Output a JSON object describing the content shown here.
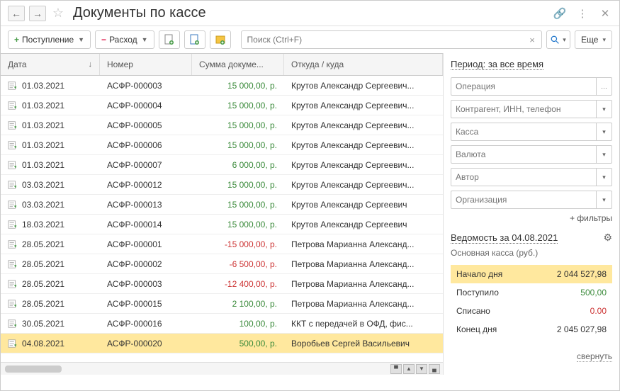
{
  "header": {
    "title": "Документы по кассе"
  },
  "toolbar": {
    "income_btn": "Поступление",
    "expense_btn": "Расход",
    "search_placeholder": "Поиск (Ctrl+F)",
    "more_btn": "Еще"
  },
  "columns": {
    "date": "Дата",
    "number": "Номер",
    "sum": "Сумма докуме...",
    "where": "Откуда / куда"
  },
  "rows": [
    {
      "date": "01.03.2021",
      "num": "АСФР-000003",
      "amt": "15 000,00, р.",
      "cls": "pos",
      "who": "Крутов Александр Сергеевич..."
    },
    {
      "date": "01.03.2021",
      "num": "АСФР-000004",
      "amt": "15 000,00, р.",
      "cls": "pos",
      "who": "Крутов Александр Сергеевич..."
    },
    {
      "date": "01.03.2021",
      "num": "АСФР-000005",
      "amt": "15 000,00, р.",
      "cls": "pos",
      "who": "Крутов Александр Сергеевич..."
    },
    {
      "date": "01.03.2021",
      "num": "АСФР-000006",
      "amt": "15 000,00, р.",
      "cls": "pos",
      "who": "Крутов Александр Сергеевич..."
    },
    {
      "date": "01.03.2021",
      "num": "АСФР-000007",
      "amt": "6 000,00, р.",
      "cls": "pos",
      "who": "Крутов Александр Сергеевич..."
    },
    {
      "date": "03.03.2021",
      "num": "АСФР-000012",
      "amt": "15 000,00, р.",
      "cls": "pos",
      "who": "Крутов Александр Сергеевич..."
    },
    {
      "date": "03.03.2021",
      "num": "АСФР-000013",
      "amt": "15 000,00, р.",
      "cls": "pos",
      "who": "Крутов Александр Сергеевич"
    },
    {
      "date": "18.03.2021",
      "num": "АСФР-000014",
      "amt": "15 000,00, р.",
      "cls": "pos",
      "who": "Крутов Александр Сергеевич"
    },
    {
      "date": "28.05.2021",
      "num": "АСФР-000001",
      "amt": "-15 000,00, р.",
      "cls": "neg",
      "who": "Петрова Марианна Александ..."
    },
    {
      "date": "28.05.2021",
      "num": "АСФР-000002",
      "amt": "-6 500,00, р.",
      "cls": "neg",
      "who": "Петрова Марианна Александ..."
    },
    {
      "date": "28.05.2021",
      "num": "АСФР-000003",
      "amt": "-12 400,00, р.",
      "cls": "neg",
      "who": "Петрова Марианна Александ..."
    },
    {
      "date": "28.05.2021",
      "num": "АСФР-000015",
      "amt": "2 100,00, р.",
      "cls": "pos",
      "who": "Петрова Марианна Александ..."
    },
    {
      "date": "30.05.2021",
      "num": "АСФР-000016",
      "amt": "100,00, р.",
      "cls": "pos",
      "who": "ККТ с передачей в ОФД, фис..."
    },
    {
      "date": "04.08.2021",
      "num": "АСФР-000020",
      "amt": "500,00, р.",
      "cls": "pos",
      "who": "Воробьев Сергей Васильевич",
      "sel": true
    }
  ],
  "side": {
    "period": "Период: за все время",
    "filters": {
      "operation": "Операция",
      "counterparty": "Контрагент, ИНН, телефон",
      "cash": "Касса",
      "currency": "Валюта",
      "author": "Автор",
      "org": "Организация"
    },
    "add_filters": "+ фильтры",
    "stmt_title": "Ведомость за 04.08.2021",
    "stmt_sub": "Основная касса (руб.)",
    "rows": [
      {
        "label": "Начало дня",
        "val": "2 044 527,98",
        "hl": true
      },
      {
        "label": "Поступило",
        "val": "500,00",
        "cls": "pos"
      },
      {
        "label": "Списано",
        "val": "0.00",
        "cls": "neg"
      },
      {
        "label": "Конец дня",
        "val": "2 045 027,98"
      }
    ],
    "collapse": "свернуть"
  }
}
